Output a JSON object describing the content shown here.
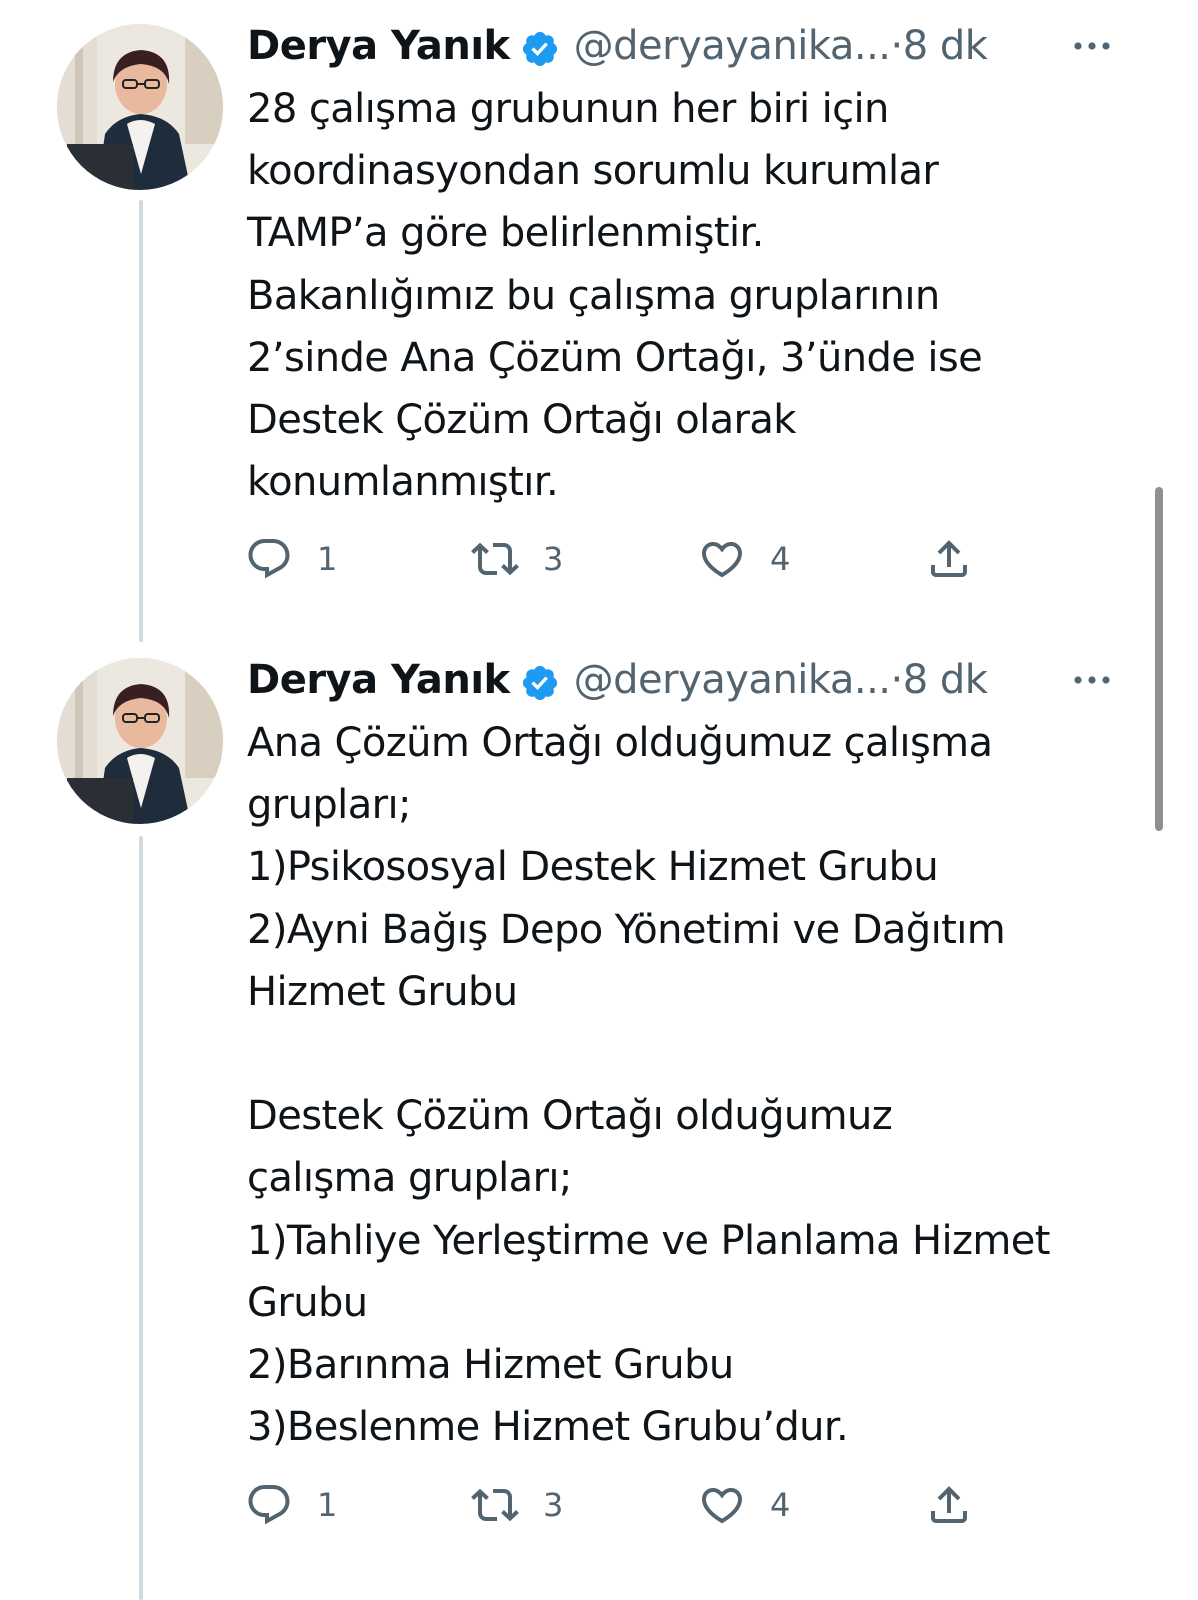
{
  "tweets": [
    {
      "author": {
        "name": "Derya Yanık",
        "handle": "@deryayanika...",
        "time": "·8 dk",
        "verified": true
      },
      "text": "28 çalışma grubunun her biri için\nkoordinasyondan sorumlu kurumlar\nTAMP’a göre belirlenmiştir.\nBakanlığımız bu çalışma gruplarının\n2’sinde Ana Çözüm Ortağı, 3’ünde ise\nDestek Çözüm Ortağı olarak\nkonumlanmıştır.",
      "counts": {
        "reply": "1",
        "retweet": "3",
        "like": "4"
      }
    },
    {
      "author": {
        "name": "Derya Yanık",
        "handle": "@deryayanika...",
        "time": "·8 dk",
        "verified": true
      },
      "text": "Ana Çözüm Ortağı olduğumuz çalışma\ngrupları;\n1)Psikososyal Destek Hizmet Grubu\n2)Ayni Bağış Depo Yönetimi ve Dağıtım\nHizmet Grubu\n\nDestek Çözüm Ortağı olduğumuz\nçalışma grupları;\n1)Tahliye Yerleştirme ve Planlama Hizmet\nGrubu\n2)Barınma Hizmet Grubu\n3)Beslenme Hizmet Grubu’dur.",
      "counts": {
        "reply": "1",
        "retweet": "3",
        "like": "4"
      }
    }
  ],
  "colors": {
    "verified": "#1d9bf0",
    "secondary_text": "#536471",
    "thread_line": "#cfd9de"
  },
  "icons": {
    "verified": "verified-badge-icon",
    "more": "more-dots-icon",
    "reply": "reply-bubble-icon",
    "retweet": "retweet-arrows-icon",
    "like": "heart-icon",
    "share": "share-upload-icon"
  }
}
